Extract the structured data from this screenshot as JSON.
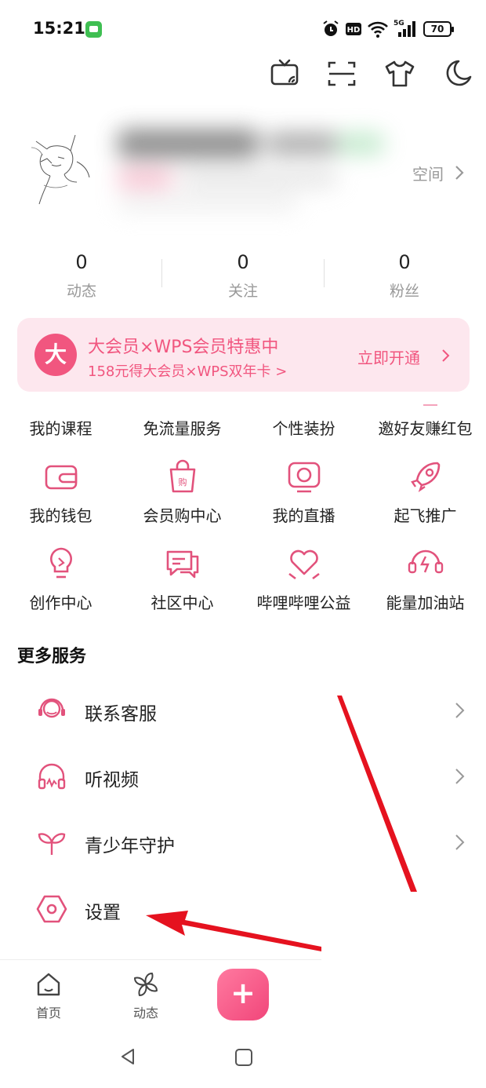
{
  "status_bar": {
    "time": "15:21",
    "network": "5G",
    "battery": "70"
  },
  "profile": {
    "space_label": "空间"
  },
  "stats": [
    {
      "value": "0",
      "label": "动态"
    },
    {
      "value": "0",
      "label": "关注"
    },
    {
      "value": "0",
      "label": "粉丝"
    }
  ],
  "vip_banner": {
    "badge": "大",
    "title": "大会员×WPS会员特惠中",
    "subtitle": "158元得大会员×WPS双年卡 >",
    "button": "立即开通"
  },
  "services_row1": [
    "我的课程",
    "免流量服务",
    "个性装扮",
    "邀好友赚红包"
  ],
  "services_row2": [
    "我的钱包",
    "会员购中心",
    "我的直播",
    "起飞推广"
  ],
  "services_row3": [
    "创作中心",
    "社区中心",
    "哔哩哔哩公益",
    "能量加油站"
  ],
  "more_services": {
    "title": "更多服务",
    "items": [
      "联系客服",
      "听视频",
      "青少年守护",
      "设置"
    ]
  },
  "bottom_nav": {
    "home": "首页",
    "dynamic": "动态",
    "plus": "+"
  },
  "colors": {
    "accent": "#f1567f",
    "banner_bg": "#fde7ee",
    "annotation_arrow": "#e5121f"
  }
}
